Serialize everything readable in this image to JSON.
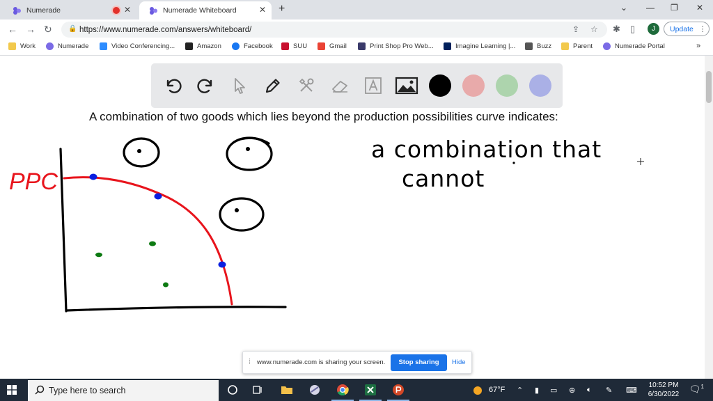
{
  "browser": {
    "tabs": [
      {
        "label": "Numerade",
        "active": false,
        "recording": true
      },
      {
        "label": "Numerade Whiteboard",
        "active": true,
        "recording": false
      }
    ],
    "url": "https://www.numerade.com/answers/whiteboard/",
    "profile_initial": "J",
    "update_label": "Update",
    "bookmarks": [
      {
        "label": "Work",
        "icon": "folder-icon"
      },
      {
        "label": "Numerade",
        "icon": "numerade-icon"
      },
      {
        "label": "Video Conferencing...",
        "icon": "video-icon"
      },
      {
        "label": "Amazon",
        "icon": "amazon-icon"
      },
      {
        "label": "Facebook",
        "icon": "facebook-icon"
      },
      {
        "label": "SUU",
        "icon": "suu-icon"
      },
      {
        "label": "Gmail",
        "icon": "gmail-icon"
      },
      {
        "label": "Print Shop Pro Web...",
        "icon": "print-icon"
      },
      {
        "label": "Imagine Learning |...",
        "icon": "imagine-icon"
      },
      {
        "label": "Buzz",
        "icon": "buzz-icon"
      },
      {
        "label": "Parent",
        "icon": "folder-icon"
      },
      {
        "label": "Numerade Portal",
        "icon": "numerade-icon"
      }
    ],
    "more_bookmarks": "»"
  },
  "whiteboard": {
    "tools": [
      "undo-icon",
      "redo-icon",
      "pointer-icon",
      "pen-icon",
      "tools-icon",
      "eraser-icon",
      "text-icon",
      "image-icon"
    ],
    "colors": [
      {
        "name": "black",
        "hex": "#000000",
        "selected": true
      },
      {
        "name": "red",
        "hex": "#e8aaaa",
        "selected": false
      },
      {
        "name": "green",
        "hex": "#add4ad",
        "selected": false
      },
      {
        "name": "blue",
        "hex": "#aab0e6",
        "selected": false
      }
    ],
    "question": "A combination of two goods which lies beyond the production possibilities curve indicates:",
    "handwriting": {
      "ppc_label": "PPC",
      "answer_line1": "a combination that",
      "answer_line2": "cannot"
    },
    "ink_colors": {
      "black": "#000000",
      "red": "#e8141c",
      "blue": "#0a1fe0",
      "green": "#0d7a12"
    }
  },
  "share_bar": {
    "message": "www.numerade.com is sharing your screen.",
    "stop_label": "Stop sharing",
    "hide_label": "Hide"
  },
  "taskbar": {
    "search_placeholder": "Type here to search",
    "weather": "67°F",
    "time": "10:52 PM",
    "date": "6/30/2022",
    "notification_count": "1"
  }
}
